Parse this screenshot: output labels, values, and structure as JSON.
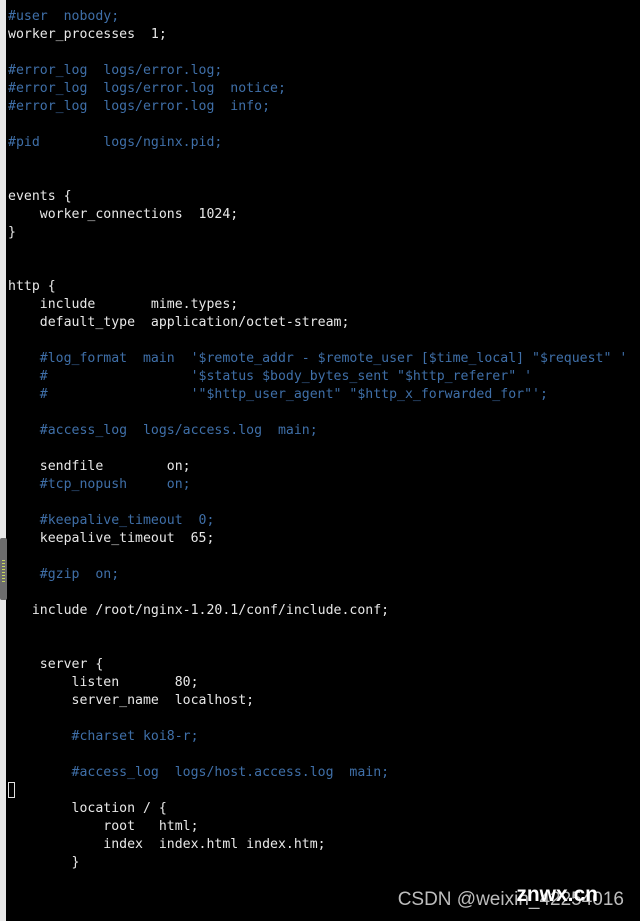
{
  "colors": {
    "background": "#000000",
    "text": "#e8e8e8",
    "comment": "#3f6fa8"
  },
  "lines": [
    {
      "t": "#user  nobody;",
      "c": true
    },
    {
      "t": "worker_processes  1;",
      "c": false
    },
    {
      "t": "",
      "c": false
    },
    {
      "t": "#error_log  logs/error.log;",
      "c": true
    },
    {
      "t": "#error_log  logs/error.log  notice;",
      "c": true
    },
    {
      "t": "#error_log  logs/error.log  info;",
      "c": true
    },
    {
      "t": "",
      "c": false
    },
    {
      "t": "#pid        logs/nginx.pid;",
      "c": true
    },
    {
      "t": "",
      "c": false
    },
    {
      "t": "",
      "c": false
    },
    {
      "t": "events {",
      "c": false
    },
    {
      "t": "    worker_connections  1024;",
      "c": false
    },
    {
      "t": "}",
      "c": false
    },
    {
      "t": "",
      "c": false
    },
    {
      "t": "",
      "c": false
    },
    {
      "t": "http {",
      "c": false
    },
    {
      "t": "    include       mime.types;",
      "c": false
    },
    {
      "t": "    default_type  application/octet-stream;",
      "c": false
    },
    {
      "t": "",
      "c": false
    },
    {
      "t": "    #log_format  main  '$remote_addr - $remote_user [$time_local] \"$request\" '",
      "c": true
    },
    {
      "t": "    #                  '$status $body_bytes_sent \"$http_referer\" '",
      "c": true
    },
    {
      "t": "    #                  '\"$http_user_agent\" \"$http_x_forwarded_for\"';",
      "c": true
    },
    {
      "t": "",
      "c": false
    },
    {
      "t": "    #access_log  logs/access.log  main;",
      "c": true
    },
    {
      "t": "",
      "c": false
    },
    {
      "t": "    sendfile        on;",
      "c": false
    },
    {
      "t": "    #tcp_nopush     on;",
      "c": true
    },
    {
      "t": "",
      "c": false
    },
    {
      "t": "    #keepalive_timeout  0;",
      "c": true
    },
    {
      "t": "    keepalive_timeout  65;",
      "c": false
    },
    {
      "t": "",
      "c": false
    },
    {
      "t": "    #gzip  on;",
      "c": true
    },
    {
      "t": "",
      "c": false
    },
    {
      "t": "   include /root/nginx-1.20.1/conf/include.conf;",
      "c": false
    },
    {
      "t": "",
      "c": false
    },
    {
      "t": "",
      "c": false
    },
    {
      "t": "    server {",
      "c": false
    },
    {
      "t": "        listen       80;",
      "c": false
    },
    {
      "t": "        server_name  localhost;",
      "c": false
    },
    {
      "t": "",
      "c": false
    },
    {
      "t": "        #charset koi8-r;",
      "c": true
    },
    {
      "t": "",
      "c": false
    },
    {
      "t": "        #access_log  logs/host.access.log  main;",
      "c": true
    },
    {
      "t": "",
      "c": false
    },
    {
      "t": "        location / {",
      "c": false
    },
    {
      "t": "            root   html;",
      "c": false
    },
    {
      "t": "            index  index.html index.htm;",
      "c": false
    },
    {
      "t": "        }",
      "c": false
    }
  ],
  "watermark": "CSDN @weixin_42254016",
  "brand": "znwx.cn"
}
